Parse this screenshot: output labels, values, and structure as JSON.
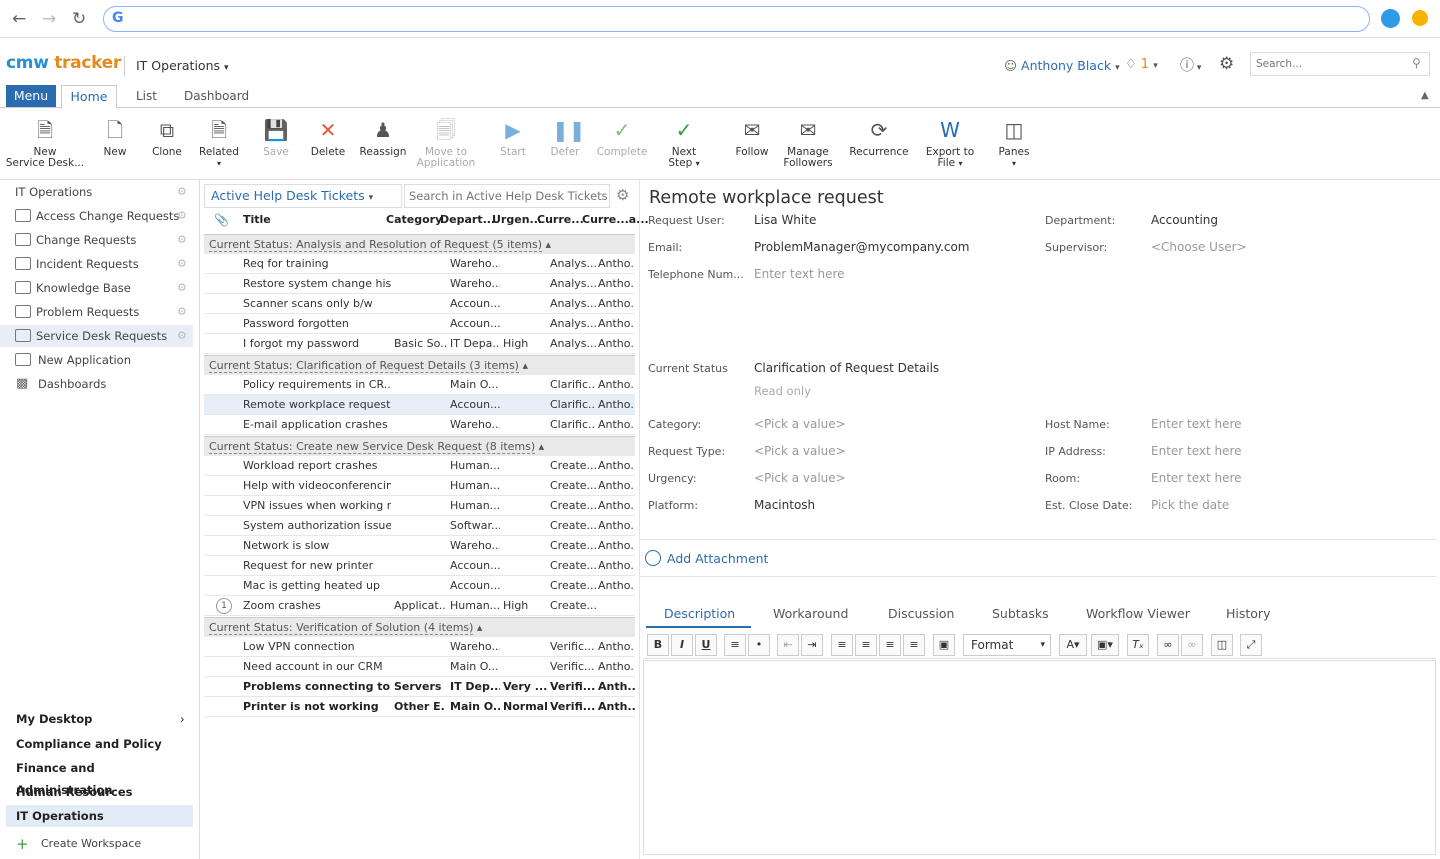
{
  "app": {
    "logo_part1": "cmw",
    "logo_part2": "tracker",
    "workspace": "IT Operations",
    "user": "Anthony Black",
    "notifications": "1",
    "search_placeholder": "Search..."
  },
  "ribbon": {
    "menu": "Menu",
    "tabs": [
      "Home",
      "List",
      "Dashboard"
    ]
  },
  "toolbar": [
    {
      "label": "New\nService Desk...",
      "disabled": false
    },
    {
      "label": "New",
      "disabled": false
    },
    {
      "label": "Clone",
      "disabled": false
    },
    {
      "label": "Related",
      "disabled": false
    },
    {
      "label": "Save",
      "disabled": true
    },
    {
      "label": "Delete",
      "disabled": false
    },
    {
      "label": "Reassign",
      "disabled": false
    },
    {
      "label": "Move to\nApplication",
      "disabled": true
    },
    {
      "label": "Start",
      "disabled": true
    },
    {
      "label": "Defer",
      "disabled": true
    },
    {
      "label": "Complete",
      "disabled": true
    },
    {
      "label": "Next\nStep",
      "disabled": false
    },
    {
      "label": "Follow",
      "disabled": false
    },
    {
      "label": "Manage\nFollowers",
      "disabled": false
    },
    {
      "label": "Recurrence",
      "disabled": false
    },
    {
      "label": "Export to\nFile",
      "disabled": false
    },
    {
      "label": "Panes",
      "disabled": false
    }
  ],
  "sidebar": {
    "root": "IT Operations",
    "items": [
      "Access Change Requests",
      "Change Requests",
      "Incident Requests",
      "Knowledge Base",
      "Problem Requests",
      "Service Desk Requests"
    ],
    "new_app": "New Application",
    "dashboards": "Dashboards",
    "workspaces": [
      "My Desktop",
      "Compliance and Policy",
      "Finance and Administration",
      "Human Resources",
      "IT Operations"
    ],
    "create_workspace": "Create Workspace"
  },
  "grid": {
    "view": "Active Help Desk Tickets",
    "search_placeholder": "Search in Active Help Desk Tickets",
    "columns": [
      "Title",
      "Category",
      "Depart...",
      "Urgen...",
      "Curre...",
      "Curre...a..."
    ],
    "groups": [
      {
        "label": "Current Status: Analysis and Resolution of Request (5 items)",
        "rows": [
          [
            "Req for training",
            "",
            "Wareho...",
            "",
            "Analys...",
            "Antho..."
          ],
          [
            "Restore system change his...",
            "",
            "Wareho...",
            "",
            "Analys...",
            "Antho..."
          ],
          [
            "Scanner scans only b/w",
            "",
            "Accoun...",
            "",
            "Analys...",
            "Antho..."
          ],
          [
            "Password forgotten",
            "",
            "Accoun...",
            "",
            "Analys...",
            "Antho..."
          ],
          [
            "I forgot my password",
            "Basic So...",
            "IT Depa...",
            "High",
            "Analys...",
            "Antho..."
          ]
        ]
      },
      {
        "label": "Current Status: Clarification of Request Details (3 items)",
        "rows": [
          [
            "Policy requirements in CR...",
            "",
            "Main O...",
            "",
            "Clarific...",
            "Antho..."
          ],
          [
            "Remote workplace request",
            "",
            "Accoun...",
            "",
            "Clarific...",
            "Antho..."
          ],
          [
            "E-mail application crashes ...",
            "",
            "Wareho...",
            "",
            "Clarific...",
            "Antho..."
          ]
        ]
      },
      {
        "label": "Current Status: Create new Service Desk Request (8 items)",
        "rows": [
          [
            "Workload report crashes",
            "",
            "Human...",
            "",
            "Create...",
            "Antho..."
          ],
          [
            "Help with videoconferencing",
            "",
            "Human...",
            "",
            "Create...",
            "Antho..."
          ],
          [
            "VPN issues when working r...",
            "",
            "Human...",
            "",
            "Create...",
            "Antho..."
          ],
          [
            "System authorization issue",
            "",
            "Softwar...",
            "",
            "Create...",
            "Antho..."
          ],
          [
            "Network is slow",
            "",
            "Wareho...",
            "",
            "Create...",
            "Antho..."
          ],
          [
            "Request for new printer",
            "",
            "Accoun...",
            "",
            "Create...",
            "Antho..."
          ],
          [
            "Mac is getting heated up",
            "",
            "Accoun...",
            "",
            "Create...",
            "Antho..."
          ],
          [
            "Zoom crashes",
            "Applicat...",
            "Human...",
            "High",
            "Create...",
            ""
          ]
        ]
      },
      {
        "label": "Current Status: Verification of Solution (4 items)",
        "rows": [
          [
            "Low VPN connection",
            "",
            "Wareho...",
            "",
            "Verific...",
            "Antho..."
          ],
          [
            "Need account in our CRM",
            "",
            "Main O...",
            "",
            "Verific...",
            "Antho..."
          ],
          [
            "Problems connecting to ...",
            "Servers",
            "IT Dep...",
            "Very ...",
            "Verifi...",
            "Anth..."
          ],
          [
            "Printer is not working",
            "Other E...",
            "Main O...",
            "Normal",
            "Verifi...",
            "Anth..."
          ]
        ]
      }
    ],
    "zoom_badge": "1"
  },
  "detail": {
    "title": "Remote workplace request",
    "request_user_label": "Request User:",
    "request_user": "Lisa White",
    "email_label": "Email:",
    "email": "ProblemManager@mycompany.com",
    "phone_label": "Telephone Num...",
    "phone_ph": "Enter text here",
    "department_label": "Department:",
    "department": "Accounting",
    "supervisor_label": "Supervisor:",
    "supervisor_ph": "<Choose User>",
    "status_label": "Current Status",
    "status": "Clarification of Request Details",
    "read_only": "Read only",
    "category_label": "Category:",
    "category_ph": "<Pick a value>",
    "request_type_label": "Request Type:",
    "request_type_ph": "<Pick a value>",
    "urgency_label": "Urgency:",
    "urgency_ph": "<Pick a value>",
    "platform_label": "Platform:",
    "platform": "Macintosh",
    "host_label": "Host Name:",
    "host_ph": "Enter text here",
    "ip_label": "IP Address:",
    "ip_ph": "Enter text here",
    "room_label": "Room:",
    "room_ph": "Enter text here",
    "close_label": "Est. Close Date:",
    "close_ph": "Pick the date",
    "add_attachment": "Add Attachment",
    "tabs": [
      "Description",
      "Workaround",
      "Discussion",
      "Subtasks",
      "Workflow Viewer",
      "History"
    ],
    "format": "Format"
  }
}
